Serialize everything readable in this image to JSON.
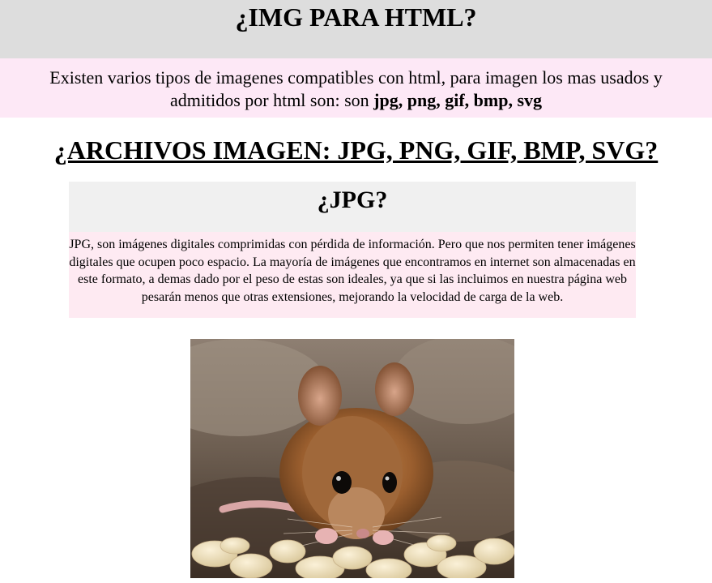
{
  "header": {
    "title": "¿IMG PARA HTML?"
  },
  "intro": {
    "text": "Existen varios tipos de imagenes compatibles con html, para imagen los mas usados y admitidos por html son: son ",
    "formats": "jpg, png, gif, bmp, svg"
  },
  "section": {
    "heading": "¿ARCHIVOS IMAGEN: JPG, PNG, GIF, BMP, SVG?"
  },
  "jpg": {
    "title": "¿JPG?",
    "description": "JPG, son imágenes digitales comprimidas con pérdida de información. Pero que nos permiten tener imágenes digitales que ocupen poco espacio. La mayoría de imágenes que encontramos en internet son almacenadas en este formato, a demas dado por el peso de estas son ideales, ya que si las incluimos en nuestra página web pesarán menos que otras extensiones, mejorando la velocidad de carga de la web."
  }
}
